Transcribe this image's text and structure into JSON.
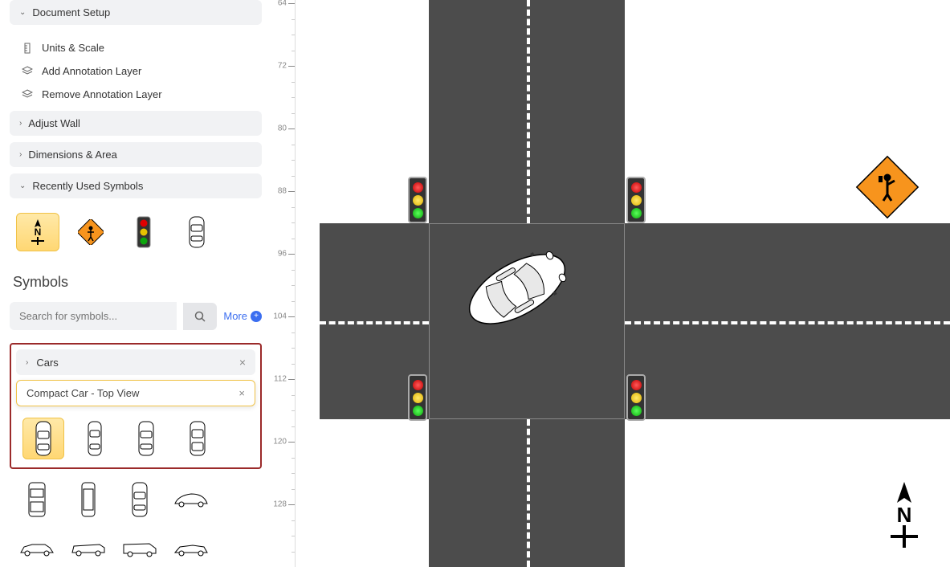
{
  "sidebar": {
    "document_setup": {
      "label": "Document Setup",
      "items": {
        "units_scale": "Units & Scale",
        "add_annotation": "Add Annotation Layer",
        "remove_annotation": "Remove Annotation Layer"
      }
    },
    "adjust_wall": "Adjust Wall",
    "dimensions_area": "Dimensions & Area",
    "recently_used": "Recently Used Symbols",
    "recent_symbols": [
      "north-arrow",
      "flagger-sign",
      "traffic-light",
      "car-top"
    ],
    "symbols_title": "Symbols",
    "search_placeholder": "Search for symbols...",
    "more_label": "More",
    "cars": {
      "label": "Cars",
      "tooltip": "Compact Car - Top View",
      "items": [
        "compact-top",
        "sedan-top-1",
        "sedan-top-2",
        "sedan-top-3",
        "suv-top-1",
        "van-top",
        "sedan-top-4",
        "beetle-side",
        "sedan-side-1",
        "wagon-side",
        "van-side",
        "sports-side"
      ],
      "selected_index": 0
    }
  },
  "canvas": {
    "ruler_ticks": [
      "64",
      "72",
      "80",
      "88",
      "96",
      "104",
      "112",
      "120",
      "128"
    ],
    "compass_label": "N",
    "traffic_lights": [
      {
        "pos": "top-left"
      },
      {
        "pos": "top-right"
      },
      {
        "pos": "bottom-left"
      },
      {
        "pos": "bottom-right"
      }
    ],
    "flagger_sign": true,
    "car_rotation_deg": -30
  }
}
